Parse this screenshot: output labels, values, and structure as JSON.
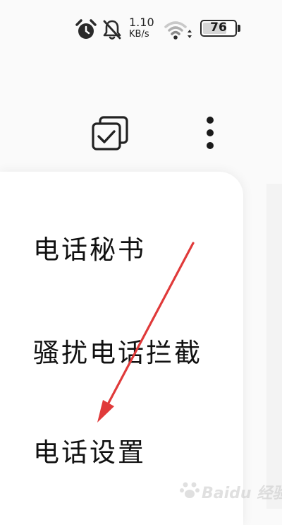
{
  "status_bar": {
    "icons": [
      "alarm-icon",
      "notifications-off-icon",
      "wifi-icon",
      "battery-icon"
    ],
    "net_speed_value": "1.10",
    "net_speed_unit": "KB/s",
    "battery_level": "76",
    "battery_fraction": 0.76
  },
  "toolbar": {
    "icons": [
      "multi-select-icon",
      "more-options-icon"
    ]
  },
  "menu": {
    "items": [
      {
        "label": "电话秘书"
      },
      {
        "label": "骚扰电话拦截"
      },
      {
        "label": "电话设置"
      }
    ]
  },
  "annotation": {
    "arrow_color": "#e03a3a"
  },
  "watermark": {
    "text": "Baidu 经验"
  },
  "colors": {
    "background": "#fafafa",
    "card": "#ffffff",
    "text": "#111111"
  }
}
